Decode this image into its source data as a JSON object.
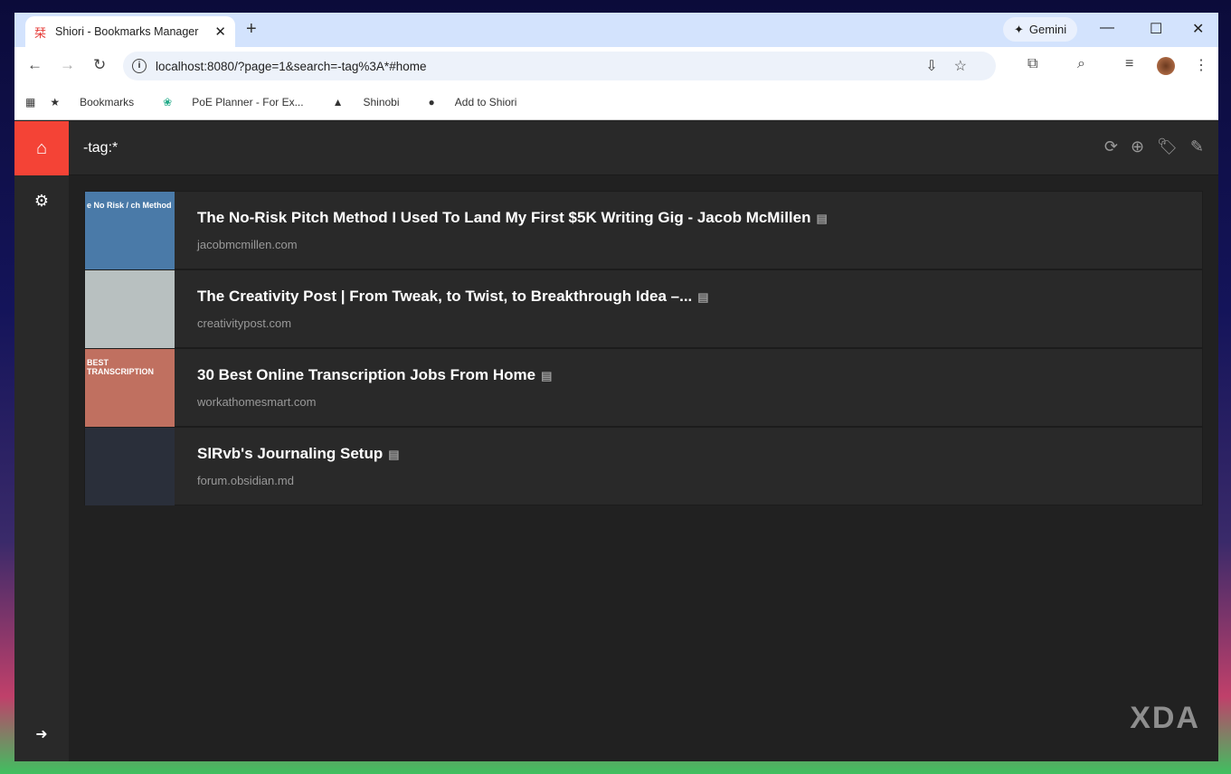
{
  "browser": {
    "tab_title": "Shiori - Bookmarks Manager",
    "gemini_label": "Gemini",
    "url": "localhost:8080/?page=1&search=-tag%3A*#home",
    "bookmarks": [
      "Bookmarks",
      "PoE Planner - For Ex...",
      "Shinobi",
      "Add to Shiori"
    ]
  },
  "app": {
    "search_query": "-tag:*",
    "items": [
      {
        "title": "The No-Risk Pitch Method I Used To Land My First $5K Writing Gig - Jacob McMillen",
        "domain": "jacobmcmillen.com",
        "thumb_text": "e No Risk / ch Method",
        "color": "#4a7aa8"
      },
      {
        "title": "The Creativity Post | From Tweak, to Twist, to Breakthrough Idea –...",
        "domain": "creativitypost.com",
        "thumb_text": "",
        "color": "#b8c0c0"
      },
      {
        "title": "30 Best Online Transcription Jobs From Home",
        "domain": "workathomesmart.com",
        "thumb_text": "BEST TRANSCRIPTION",
        "color": "#c07060"
      },
      {
        "title": "SlRvb's Journaling Setup",
        "domain": "forum.obsidian.md",
        "thumb_text": "",
        "color": "#2a2f3a"
      }
    ]
  },
  "watermark": "XDA"
}
